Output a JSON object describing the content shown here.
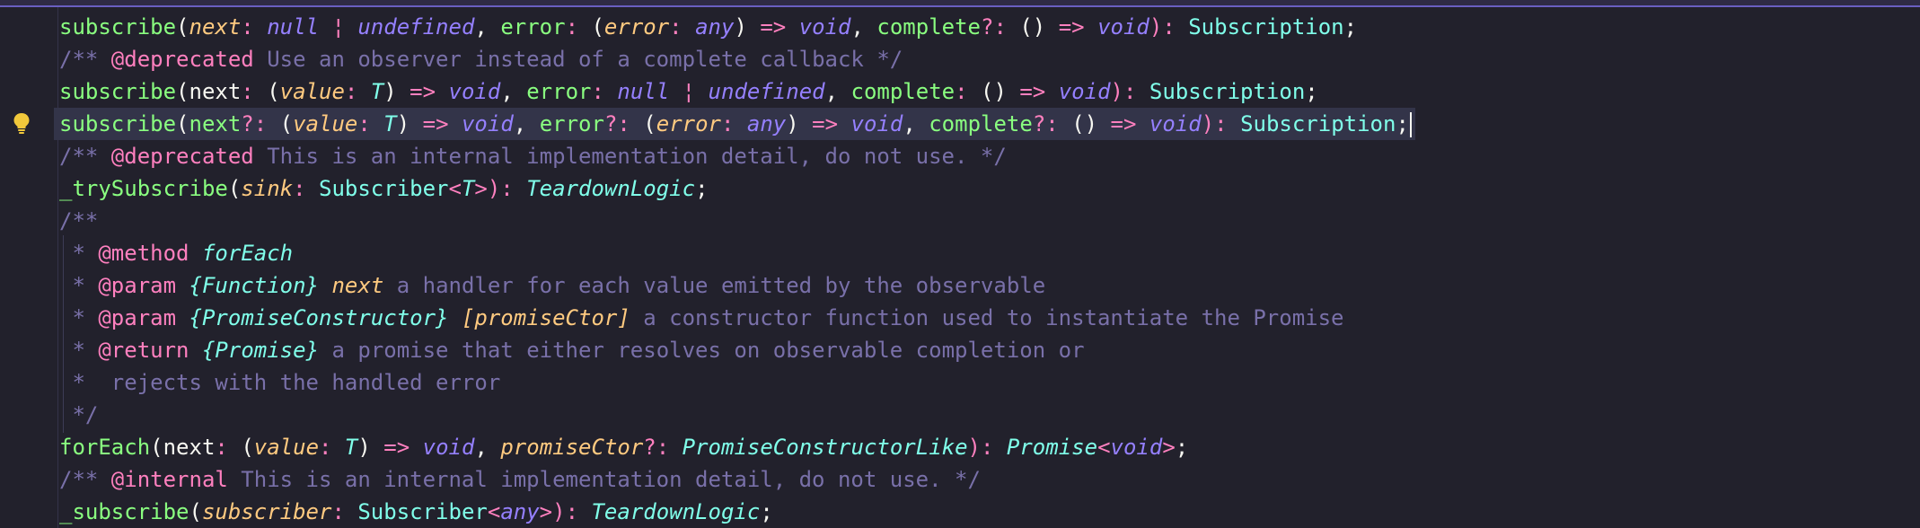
{
  "editor": {
    "language": "typescript",
    "theme_colors": {
      "background": "#22212c",
      "current_line": "#333449",
      "function": "#8aff80",
      "parameter": "#ffca80",
      "keyword": "#9580ff",
      "type": "#80ffea",
      "operator": "#ff80bf",
      "comment": "#7970a9"
    },
    "gutter_icon": "lightbulb-icon",
    "lines": [
      [
        {
          "t": "subscribe",
          "c": "fn"
        },
        {
          "t": "(",
          "c": "punc"
        },
        {
          "t": "next",
          "c": "param"
        },
        {
          "t": ": ",
          "c": "op"
        },
        {
          "t": "null",
          "c": "kw"
        },
        {
          "t": " ¦ ",
          "c": "op"
        },
        {
          "t": "undefined",
          "c": "kw"
        },
        {
          "t": ", ",
          "c": "punc"
        },
        {
          "t": "error",
          "c": "fn"
        },
        {
          "t": ": ",
          "c": "op"
        },
        {
          "t": "(",
          "c": "punc"
        },
        {
          "t": "error",
          "c": "param"
        },
        {
          "t": ": ",
          "c": "op"
        },
        {
          "t": "any",
          "c": "kw"
        },
        {
          "t": ") ",
          "c": "punc"
        },
        {
          "t": "=>",
          "c": "op"
        },
        {
          "t": " ",
          "c": "punc"
        },
        {
          "t": "void",
          "c": "kw"
        },
        {
          "t": ", ",
          "c": "punc"
        },
        {
          "t": "complete",
          "c": "fn"
        },
        {
          "t": "?: ",
          "c": "op"
        },
        {
          "t": "() ",
          "c": "punc"
        },
        {
          "t": "=>",
          "c": "op"
        },
        {
          "t": " ",
          "c": "punc"
        },
        {
          "t": "void",
          "c": "kw"
        },
        {
          "t": "): ",
          "c": "op"
        },
        {
          "t": "Subscription",
          "c": "cls"
        },
        {
          "t": ";",
          "c": "punc"
        }
      ],
      [
        {
          "t": "/** ",
          "c": "cmt"
        },
        {
          "t": "@deprecated",
          "c": "tag"
        },
        {
          "t": " Use an observer instead of a complete callback */",
          "c": "cmt"
        }
      ],
      [
        {
          "t": "subscribe",
          "c": "fn"
        },
        {
          "t": "(",
          "c": "punc"
        },
        {
          "t": "next",
          "c": "id"
        },
        {
          "t": ": ",
          "c": "op"
        },
        {
          "t": "(",
          "c": "punc"
        },
        {
          "t": "value",
          "c": "param"
        },
        {
          "t": ": ",
          "c": "op"
        },
        {
          "t": "T",
          "c": "type"
        },
        {
          "t": ") ",
          "c": "punc"
        },
        {
          "t": "=>",
          "c": "op"
        },
        {
          "t": " ",
          "c": "punc"
        },
        {
          "t": "void",
          "c": "kw"
        },
        {
          "t": ", ",
          "c": "punc"
        },
        {
          "t": "error",
          "c": "fn"
        },
        {
          "t": ": ",
          "c": "op"
        },
        {
          "t": "null",
          "c": "kw"
        },
        {
          "t": " ¦ ",
          "c": "op"
        },
        {
          "t": "undefined",
          "c": "kw"
        },
        {
          "t": ", ",
          "c": "punc"
        },
        {
          "t": "complete",
          "c": "fn"
        },
        {
          "t": ": ",
          "c": "op"
        },
        {
          "t": "() ",
          "c": "punc"
        },
        {
          "t": "=>",
          "c": "op"
        },
        {
          "t": " ",
          "c": "punc"
        },
        {
          "t": "void",
          "c": "kw"
        },
        {
          "t": "): ",
          "c": "op"
        },
        {
          "t": "Subscription",
          "c": "cls"
        },
        {
          "t": ";",
          "c": "punc"
        }
      ],
      [
        {
          "t": "subscribe",
          "c": "fn"
        },
        {
          "t": "(",
          "c": "punc"
        },
        {
          "t": "next",
          "c": "fn"
        },
        {
          "t": "?: ",
          "c": "op"
        },
        {
          "t": "(",
          "c": "punc"
        },
        {
          "t": "value",
          "c": "param"
        },
        {
          "t": ": ",
          "c": "op"
        },
        {
          "t": "T",
          "c": "type"
        },
        {
          "t": ") ",
          "c": "punc"
        },
        {
          "t": "=>",
          "c": "op"
        },
        {
          "t": " ",
          "c": "punc"
        },
        {
          "t": "void",
          "c": "kw"
        },
        {
          "t": ", ",
          "c": "punc"
        },
        {
          "t": "error",
          "c": "fn"
        },
        {
          "t": "?: ",
          "c": "op"
        },
        {
          "t": "(",
          "c": "punc"
        },
        {
          "t": "error",
          "c": "param"
        },
        {
          "t": ": ",
          "c": "op"
        },
        {
          "t": "any",
          "c": "kw"
        },
        {
          "t": ") ",
          "c": "punc"
        },
        {
          "t": "=>",
          "c": "op"
        },
        {
          "t": " ",
          "c": "punc"
        },
        {
          "t": "void",
          "c": "kw"
        },
        {
          "t": ", ",
          "c": "punc"
        },
        {
          "t": "complete",
          "c": "fn"
        },
        {
          "t": "?: ",
          "c": "op"
        },
        {
          "t": "() ",
          "c": "punc"
        },
        {
          "t": "=>",
          "c": "op"
        },
        {
          "t": " ",
          "c": "punc"
        },
        {
          "t": "void",
          "c": "kw"
        },
        {
          "t": "): ",
          "c": "op"
        },
        {
          "t": "Subscription",
          "c": "cls"
        },
        {
          "t": ";",
          "c": "punc"
        }
      ],
      [
        {
          "t": "/** ",
          "c": "cmt"
        },
        {
          "t": "@deprecated",
          "c": "tag"
        },
        {
          "t": " This is an internal implementation detail, do not use. */",
          "c": "cmt"
        }
      ],
      [
        {
          "t": "_trySubscribe",
          "c": "fn"
        },
        {
          "t": "(",
          "c": "punc"
        },
        {
          "t": "sink",
          "c": "param"
        },
        {
          "t": ": ",
          "c": "op"
        },
        {
          "t": "Subscriber",
          "c": "cls"
        },
        {
          "t": "<",
          "c": "op"
        },
        {
          "t": "T",
          "c": "type"
        },
        {
          "t": ">",
          "c": "op"
        },
        {
          "t": "): ",
          "c": "op"
        },
        {
          "t": "TeardownLogic",
          "c": "type"
        },
        {
          "t": ";",
          "c": "punc"
        }
      ],
      [
        {
          "t": "/**",
          "c": "cmt"
        }
      ],
      [
        {
          "t": " * ",
          "c": "cmt"
        },
        {
          "t": "@method",
          "c": "tag"
        },
        {
          "t": " ",
          "c": "cmt"
        },
        {
          "t": "forEach",
          "c": "type"
        }
      ],
      [
        {
          "t": " * ",
          "c": "cmt"
        },
        {
          "t": "@param",
          "c": "tag"
        },
        {
          "t": " ",
          "c": "cmt"
        },
        {
          "t": "{Function}",
          "c": "type"
        },
        {
          "t": " ",
          "c": "cmt"
        },
        {
          "t": "next",
          "c": "param"
        },
        {
          "t": " a handler for each value emitted by the observable",
          "c": "cmt"
        }
      ],
      [
        {
          "t": " * ",
          "c": "cmt"
        },
        {
          "t": "@param",
          "c": "tag"
        },
        {
          "t": " ",
          "c": "cmt"
        },
        {
          "t": "{PromiseConstructor}",
          "c": "type"
        },
        {
          "t": " ",
          "c": "cmt"
        },
        {
          "t": "[promiseCtor]",
          "c": "param"
        },
        {
          "t": " a constructor function used to instantiate the Promise",
          "c": "cmt"
        }
      ],
      [
        {
          "t": " * ",
          "c": "cmt"
        },
        {
          "t": "@return",
          "c": "tag"
        },
        {
          "t": " ",
          "c": "cmt"
        },
        {
          "t": "{Promise}",
          "c": "type"
        },
        {
          "t": " a promise that either resolves on observable completion or",
          "c": "cmt"
        }
      ],
      [
        {
          "t": " *  rejects with the handled error",
          "c": "cmt"
        }
      ],
      [
        {
          "t": " */",
          "c": "cmt"
        }
      ],
      [
        {
          "t": "forEach",
          "c": "fn"
        },
        {
          "t": "(",
          "c": "punc"
        },
        {
          "t": "next",
          "c": "id"
        },
        {
          "t": ": ",
          "c": "op"
        },
        {
          "t": "(",
          "c": "punc"
        },
        {
          "t": "value",
          "c": "param"
        },
        {
          "t": ": ",
          "c": "op"
        },
        {
          "t": "T",
          "c": "type"
        },
        {
          "t": ") ",
          "c": "punc"
        },
        {
          "t": "=>",
          "c": "op"
        },
        {
          "t": " ",
          "c": "punc"
        },
        {
          "t": "void",
          "c": "kw"
        },
        {
          "t": ", ",
          "c": "punc"
        },
        {
          "t": "promiseCtor",
          "c": "param"
        },
        {
          "t": "?: ",
          "c": "op"
        },
        {
          "t": "PromiseConstructorLike",
          "c": "type"
        },
        {
          "t": "): ",
          "c": "op"
        },
        {
          "t": "Promise",
          "c": "type"
        },
        {
          "t": "<",
          "c": "op"
        },
        {
          "t": "void",
          "c": "kw"
        },
        {
          "t": ">",
          "c": "op"
        },
        {
          "t": ";",
          "c": "punc"
        }
      ],
      [
        {
          "t": "/** ",
          "c": "cmt"
        },
        {
          "t": "@internal",
          "c": "tag"
        },
        {
          "t": " This is an internal implementation detail, do not use. */",
          "c": "cmt"
        }
      ],
      [
        {
          "t": "_subscribe",
          "c": "fn"
        },
        {
          "t": "(",
          "c": "punc"
        },
        {
          "t": "subscriber",
          "c": "param"
        },
        {
          "t": ": ",
          "c": "op"
        },
        {
          "t": "Subscriber",
          "c": "cls"
        },
        {
          "t": "<",
          "c": "op"
        },
        {
          "t": "any",
          "c": "kw"
        },
        {
          "t": ">",
          "c": "op"
        },
        {
          "t": "): ",
          "c": "op"
        },
        {
          "t": "TeardownLogic",
          "c": "type"
        },
        {
          "t": ";",
          "c": "punc"
        }
      ]
    ]
  }
}
